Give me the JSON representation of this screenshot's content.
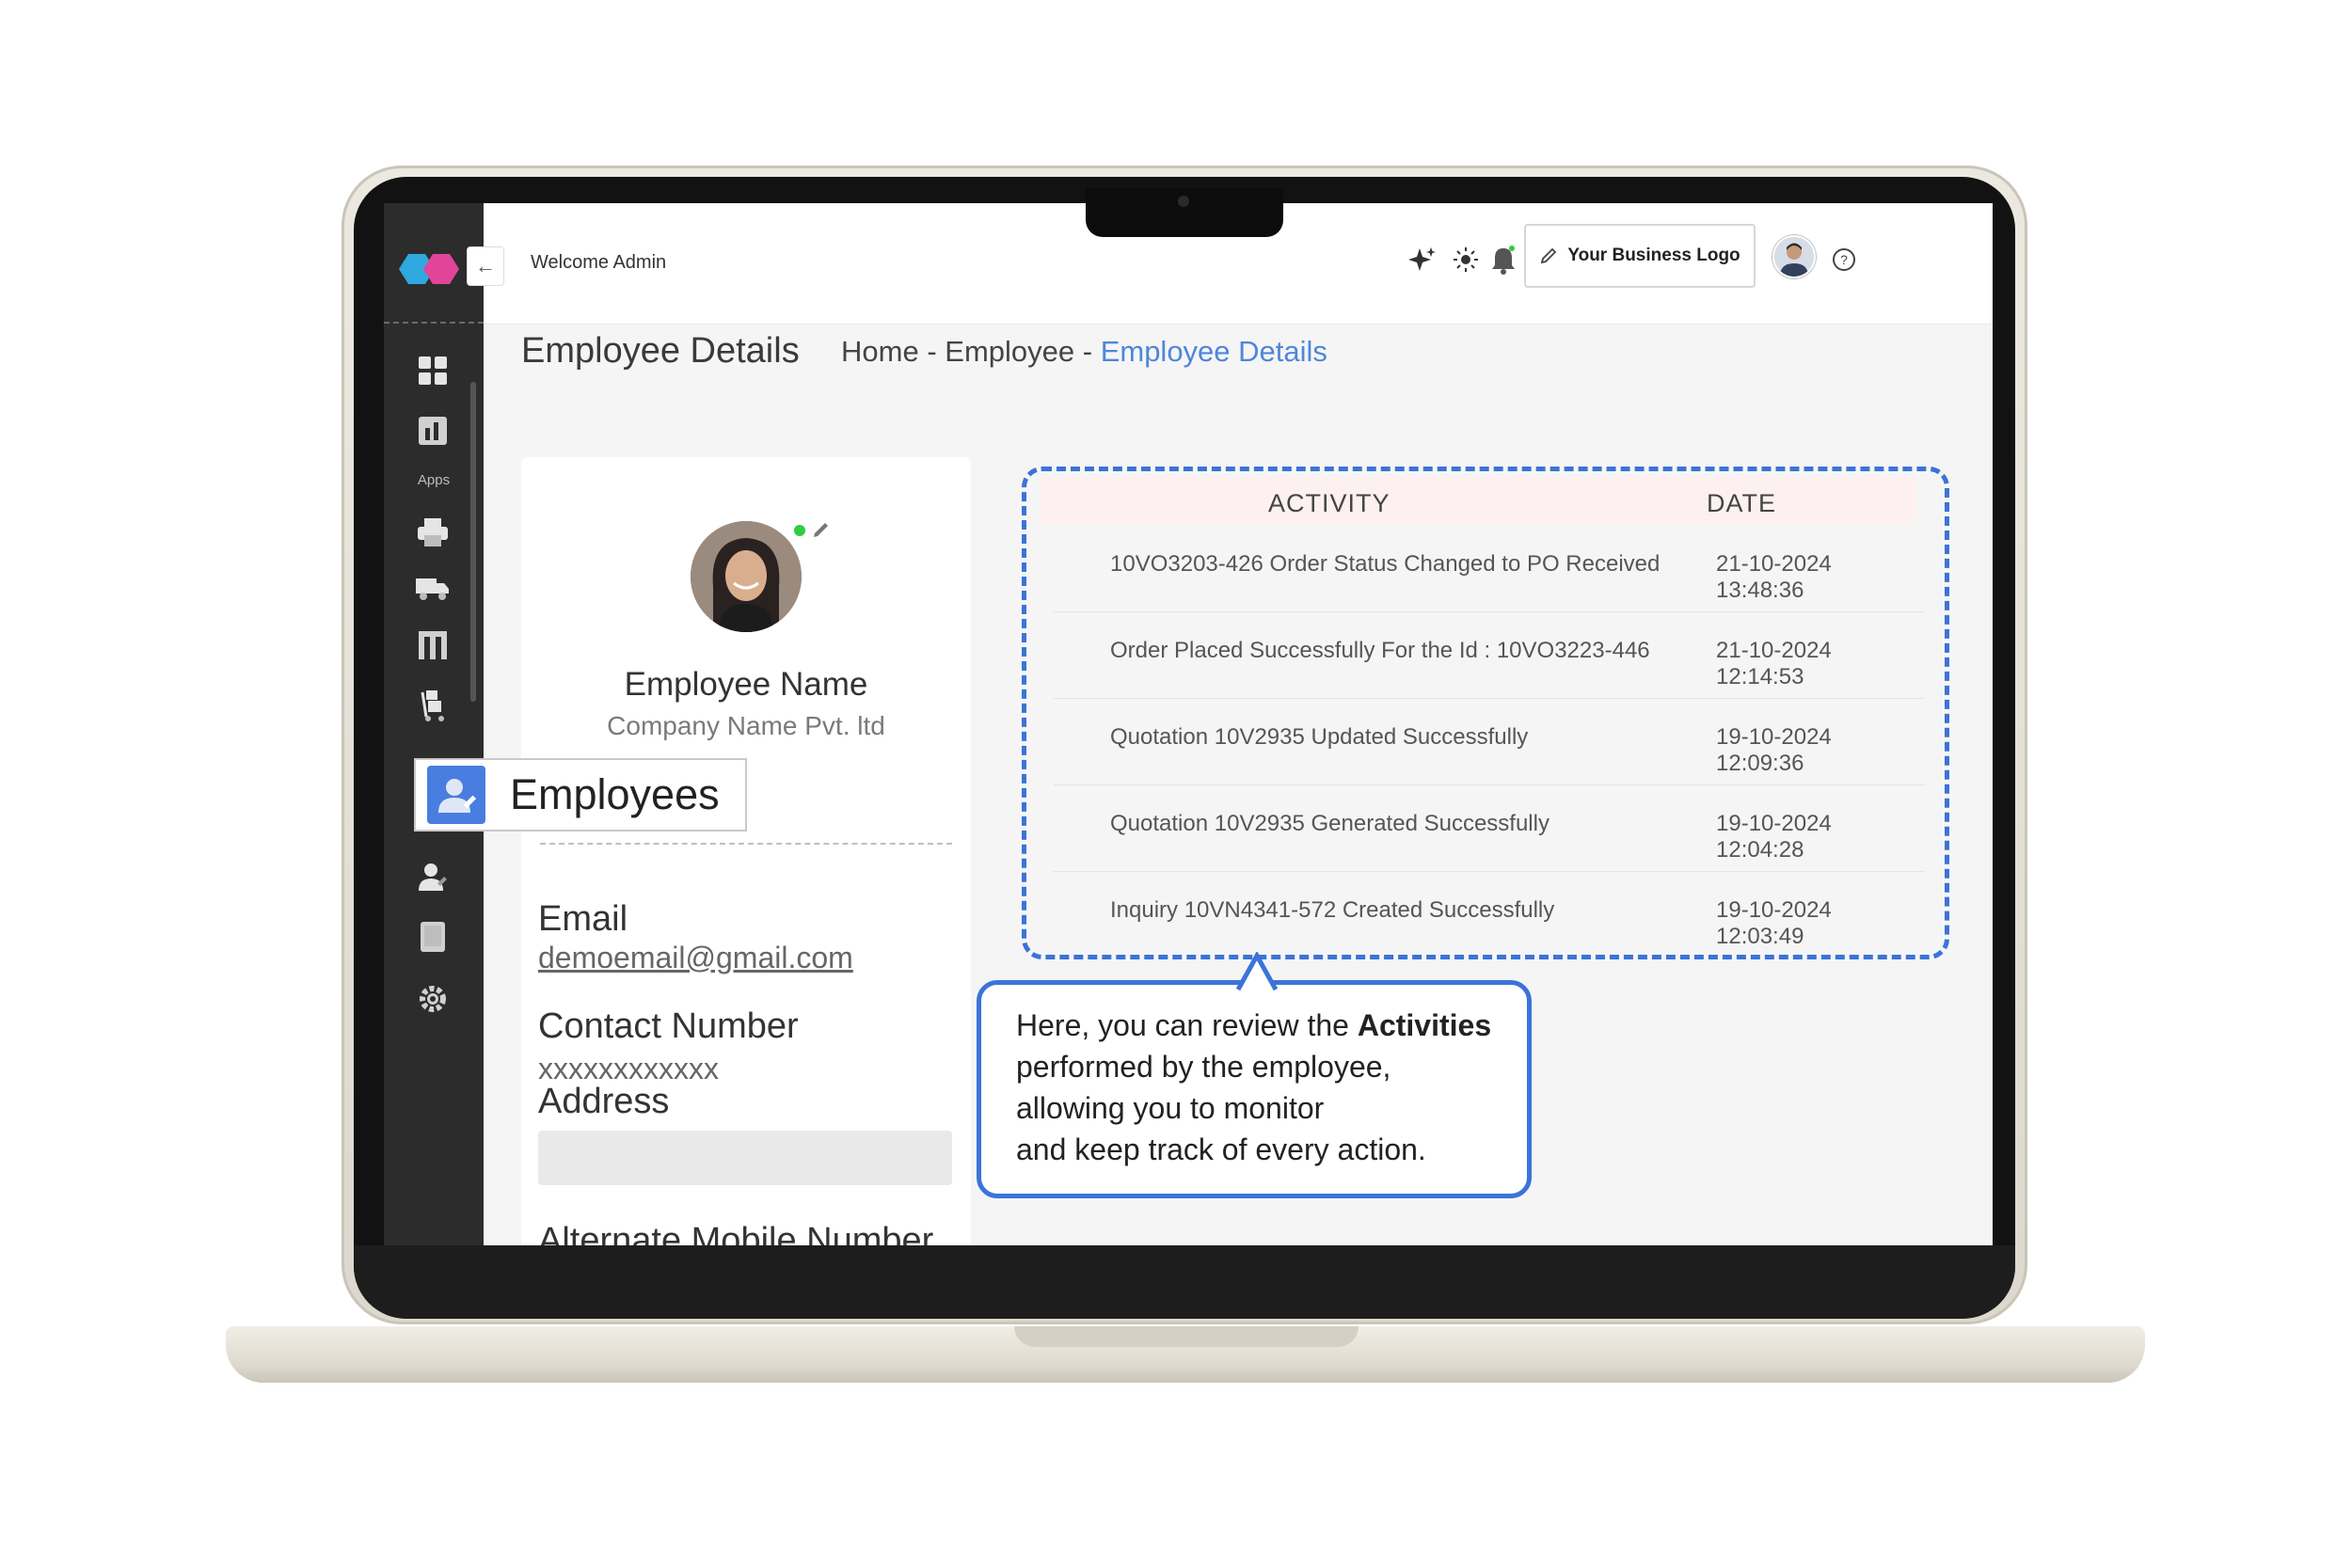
{
  "topbar": {
    "welcome": "Welcome Admin",
    "logo_button": "Your Business Logo",
    "icons": [
      "sparkle-icon",
      "sun-icon",
      "bell-icon",
      "avatar",
      "help-icon"
    ]
  },
  "sidebar": {
    "apps_label": "Apps",
    "items": [
      "dashboard-icon",
      "reports-icon",
      "printer-icon",
      "truck-icon",
      "warehouse-icon",
      "trolley-icon",
      "employee-icon",
      "book-icon",
      "gear-icon"
    ]
  },
  "page": {
    "title": "Employee Details",
    "breadcrumb": {
      "home": "Home",
      "sep1": " - ",
      "section": "Employee",
      "sep2": " - ",
      "current": "Employee Details"
    }
  },
  "profile": {
    "name": "Employee Name",
    "company": "Company Name Pvt. ltd",
    "email_label": "Email",
    "email_value": "demoemail@gmail.com",
    "contact_label": "Contact Number",
    "contact_value": "xxxxxxxxxxxx",
    "address_label": "Address",
    "alt_mobile_label": "Alternate Mobile Number"
  },
  "activity": {
    "headers": {
      "activity": "ACTIVITY",
      "date": "DATE"
    },
    "rows": [
      {
        "text": "10VO3203-426 Order Status Changed to PO Received",
        "date": "21-10-2024 13:48:36"
      },
      {
        "text": "Order Placed Successfully For the Id : 10VO3223-446",
        "date": "21-10-2024 12:14:53"
      },
      {
        "text": "Quotation 10V2935 Updated Successfully",
        "date": "19-10-2024 12:09:36"
      },
      {
        "text": "Quotation 10V2935 Generated Successfully",
        "date": "19-10-2024 12:04:28"
      },
      {
        "text": "Inquiry 10VN4341-572 Created Successfully",
        "date": "19-10-2024 12:03:49"
      }
    ]
  },
  "callout": {
    "line1_pre": "Here, you can review the ",
    "line1_bold": "Activities",
    "line2": "performed by the employee,",
    "line3": "allowing you to monitor",
    "line4": "and keep track of every action."
  },
  "badge": {
    "label": "Employees"
  },
  "colors": {
    "accent": "#3b73d8",
    "link": "#4f86d9",
    "sidebar": "#2c2c2c",
    "header_tint": "#fdf0f0"
  }
}
